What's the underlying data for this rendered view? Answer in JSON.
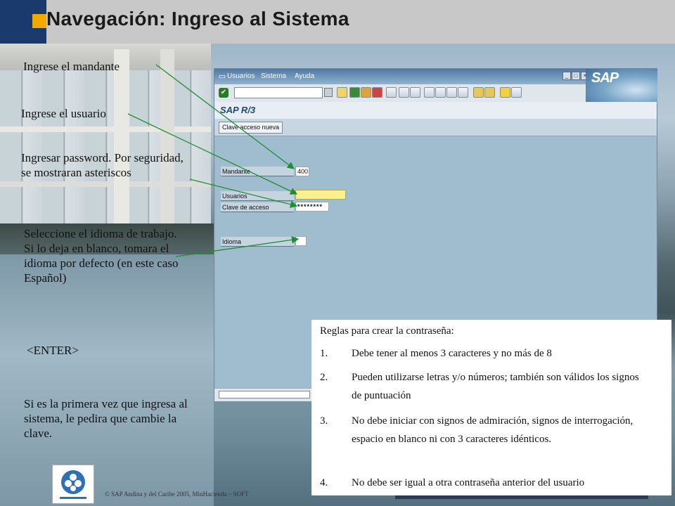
{
  "header": {
    "title": "Navegación: Ingreso al Sistema"
  },
  "sap": {
    "menu": [
      "Usuarios",
      "Sistema",
      "Ayuda"
    ],
    "logo": "SAP",
    "app_title": "SAP R/3",
    "app_button": "Clave acceso nueva",
    "fields": {
      "client_label": "Mandante",
      "client_value": "400",
      "user_label": "Usuarios",
      "user_value": "",
      "password_label": "Clave de acceso",
      "password_value": "********",
      "language_label": "Idioma",
      "language_value": ""
    }
  },
  "annotations": {
    "client": "Ingrese el mandante",
    "user": "Ingrese el usuario",
    "password": "Ingresar password. Por seguridad, se mostraran asteriscos",
    "language": "Seleccione el idioma de trabajo. Si lo deja en blanco, tomara el idioma por defecto (en este caso Español)",
    "enter": "<ENTER>",
    "first_time": "Si es la primera vez que ingresa al sistema, le pedira que cambie la clave."
  },
  "rules": {
    "title": "Reglas para crear la contraseña:",
    "items": [
      {
        "num": "1.",
        "text": "Debe tener al menos 3 caracteres y no más de 8"
      },
      {
        "num": "2.",
        "text": "Pueden utilizarse letras y/o números; también son válidos los signos de puntuación"
      },
      {
        "num": "3.",
        "text": "No debe iniciar con signos de admiración, signos de interrogación, espacio en blanco ni con 3 caracteres idénticos."
      },
      {
        "num": "4.",
        "text": "No debe ser igual a otra contraseña anterior del usuario"
      }
    ]
  },
  "footer": {
    "copyright": "©   SAP Andina y del Caribe 2005, MinHacienda – SOFT"
  },
  "colors": {
    "accent": "#f2a900",
    "arrow": "#1e8f2e",
    "header_block": "#1a3a6e",
    "sap_background": "#a0bdcf"
  }
}
